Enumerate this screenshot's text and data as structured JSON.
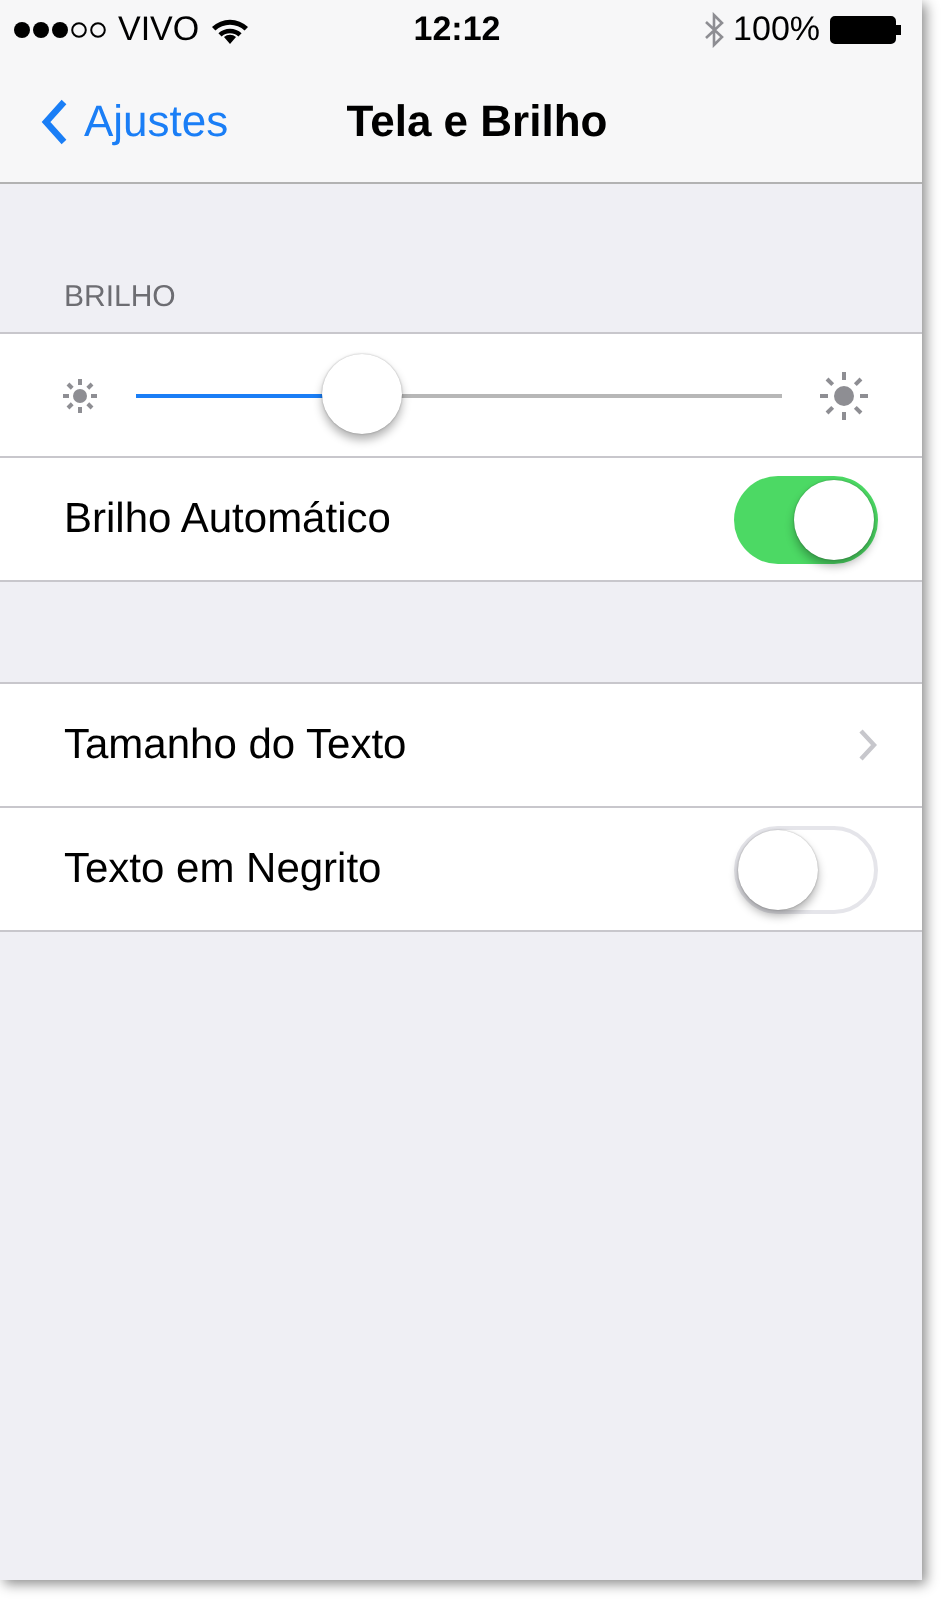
{
  "status_bar": {
    "carrier": "VIVO",
    "time": "12:12",
    "battery": "100%"
  },
  "nav_bar": {
    "back": "Ajustes",
    "title": "Tela e Brilho"
  },
  "sections": [
    {
      "header": "BRILHO",
      "rows": [
        {
          "kind": "slider",
          "level": 0.35
        },
        {
          "kind": "toggle",
          "label": "Brilho Automático",
          "on": true
        }
      ]
    },
    {
      "rows": [
        {
          "kind": "disclosure",
          "label": "Tamanho do Texto"
        },
        {
          "kind": "toggle",
          "label": "Texto em Negrito",
          "on": false
        }
      ]
    }
  ]
}
